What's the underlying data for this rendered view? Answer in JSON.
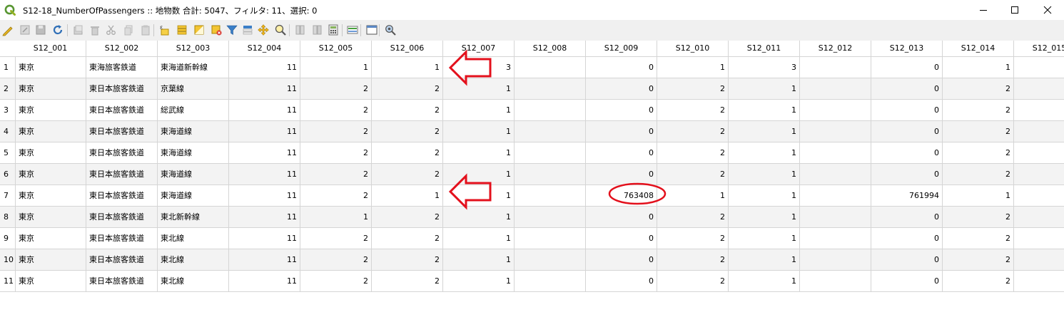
{
  "window": {
    "title": "S12-18_NumberOfPassengers :: 地物数 合計: 5047、フィルタ: 11、選択: 0",
    "minimize_icon": "minimize-icon",
    "maximize_icon": "maximize-icon",
    "close_icon": "close-icon"
  },
  "toolbar": {
    "buttons": [
      {
        "icon": "toggle-editing-icon"
      },
      {
        "icon": "multi-edit-icon"
      },
      {
        "icon": "save-edits-icon"
      },
      {
        "icon": "reload-icon"
      },
      {
        "icon": "add-feature-icon"
      },
      {
        "icon": "delete-feature-icon"
      },
      {
        "icon": "cut-icon"
      },
      {
        "icon": "copy-icon"
      },
      {
        "icon": "paste-icon"
      },
      {
        "icon": "select-by-expression-icon"
      },
      {
        "icon": "select-all-icon"
      },
      {
        "icon": "invert-selection-icon"
      },
      {
        "icon": "deselect-all-icon"
      },
      {
        "icon": "filter-icon"
      },
      {
        "icon": "move-selection-to-top-icon"
      },
      {
        "icon": "pan-to-selection-icon"
      },
      {
        "icon": "zoom-to-selection-icon"
      },
      {
        "icon": "new-field-icon"
      },
      {
        "icon": "delete-field-icon"
      },
      {
        "icon": "field-calculator-icon"
      },
      {
        "icon": "conditional-formatting-icon"
      },
      {
        "icon": "dock-table-icon"
      },
      {
        "icon": "actions-icon"
      }
    ]
  },
  "colors": {
    "annotation_red": "#e3101c",
    "row_alt": "#f3f3f3"
  },
  "table": {
    "columns": [
      "S12_001",
      "S12_002",
      "S12_003",
      "S12_004",
      "S12_005",
      "S12_006",
      "S12_007",
      "S12_008",
      "S12_009",
      "S12_010",
      "S12_011",
      "S12_012",
      "S12_013",
      "S12_014",
      "S12_015"
    ],
    "rows": [
      {
        "n": "1",
        "cells": [
          "東京",
          "東海旅客鉄道",
          "東海道新幹線",
          "11",
          "1",
          "1",
          "3",
          "",
          "0",
          "1",
          "3",
          "",
          "0",
          "1",
          ""
        ]
      },
      {
        "n": "2",
        "cells": [
          "東京",
          "東日本旅客鉄道",
          "京葉線",
          "11",
          "2",
          "2",
          "1",
          "",
          "0",
          "2",
          "1",
          "",
          "0",
          "2",
          ""
        ]
      },
      {
        "n": "3",
        "cells": [
          "東京",
          "東日本旅客鉄道",
          "総武線",
          "11",
          "2",
          "2",
          "1",
          "",
          "0",
          "2",
          "1",
          "",
          "0",
          "2",
          ""
        ]
      },
      {
        "n": "4",
        "cells": [
          "東京",
          "東日本旅客鉄道",
          "東海道線",
          "11",
          "2",
          "2",
          "1",
          "",
          "0",
          "2",
          "1",
          "",
          "0",
          "2",
          ""
        ]
      },
      {
        "n": "5",
        "cells": [
          "東京",
          "東日本旅客鉄道",
          "東海道線",
          "11",
          "2",
          "2",
          "1",
          "",
          "0",
          "2",
          "1",
          "",
          "0",
          "2",
          ""
        ]
      },
      {
        "n": "6",
        "cells": [
          "東京",
          "東日本旅客鉄道",
          "東海道線",
          "11",
          "2",
          "2",
          "1",
          "",
          "0",
          "2",
          "1",
          "",
          "0",
          "2",
          ""
        ]
      },
      {
        "n": "7",
        "cells": [
          "東京",
          "東日本旅客鉄道",
          "東海道線",
          "11",
          "2",
          "1",
          "1",
          "",
          "763408",
          "1",
          "1",
          "",
          "761994",
          "1",
          ""
        ]
      },
      {
        "n": "8",
        "cells": [
          "東京",
          "東日本旅客鉄道",
          "東北新幹線",
          "11",
          "1",
          "2",
          "1",
          "",
          "0",
          "2",
          "1",
          "",
          "0",
          "2",
          ""
        ]
      },
      {
        "n": "9",
        "cells": [
          "東京",
          "東日本旅客鉄道",
          "東北線",
          "11",
          "2",
          "2",
          "1",
          "",
          "0",
          "2",
          "1",
          "",
          "0",
          "2",
          ""
        ]
      },
      {
        "n": "10",
        "cells": [
          "東京",
          "東日本旅客鉄道",
          "東北線",
          "11",
          "2",
          "2",
          "1",
          "",
          "0",
          "2",
          "1",
          "",
          "0",
          "2",
          ""
        ]
      },
      {
        "n": "11",
        "cells": [
          "東京",
          "東日本旅客鉄道",
          "東北線",
          "11",
          "2",
          "2",
          "1",
          "",
          "0",
          "2",
          "1",
          "",
          "0",
          "2",
          ""
        ]
      }
    ]
  }
}
